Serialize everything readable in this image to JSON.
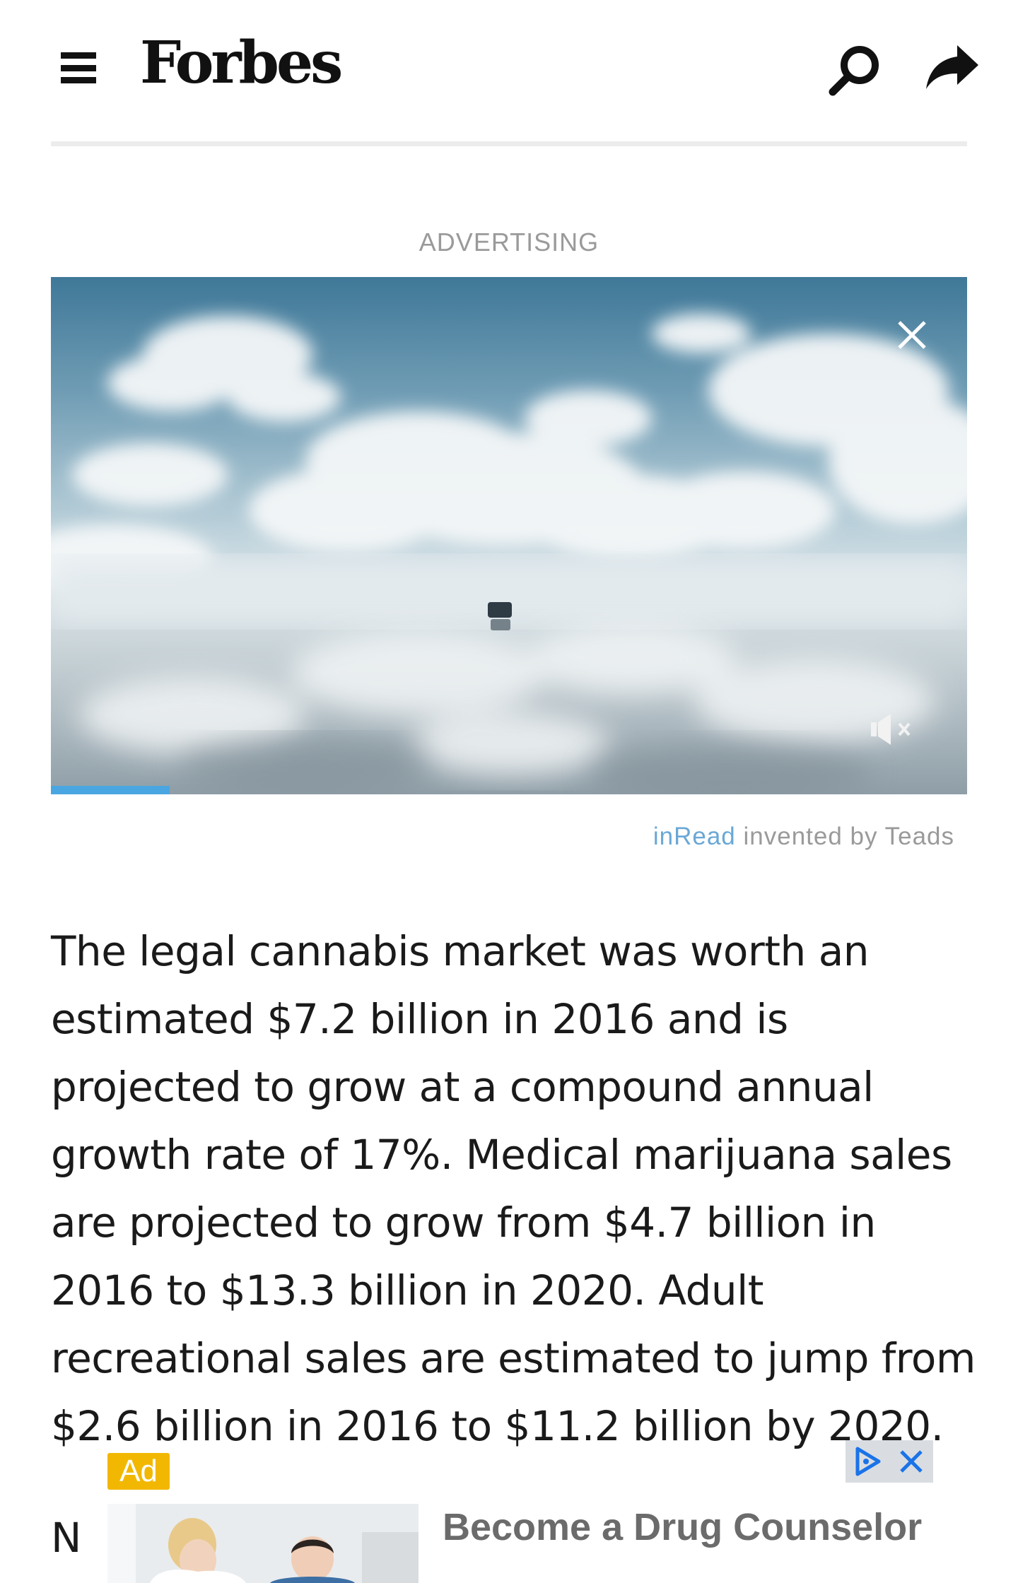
{
  "header": {
    "logo": "Forbes",
    "icons": [
      "hamburger-menu-icon",
      "search-icon",
      "share-icon"
    ]
  },
  "ad": {
    "label": "ADVERTISING",
    "video_progress_fraction": 0.13,
    "inread_brand": "inRead",
    "inread_suffix": " invented by Teads"
  },
  "article": {
    "paragraph": "The legal cannabis market was worth an estimated $7.2 billion in 2016 and is projected to grow at a compound annual growth rate of 17%. Medical marijuana sales are projected to grow from $4.7 billion in 2016 to $13.3 billion in 2020. Adult recreational sales are estimated to jump from $2.6 billion in 2016 to $11.2 billion by 2020."
  },
  "native_ad": {
    "badge": "Ad",
    "headline": "Become a Drug Counselor",
    "truncated_text": "N",
    "colors": {
      "badge": "#f2b700",
      "adchoices": "#1a73e8"
    }
  },
  "colors": {
    "progress": "#4aa6e0",
    "inread_brand": "#6aa8d6",
    "label_gray": "#9a9a9a"
  }
}
